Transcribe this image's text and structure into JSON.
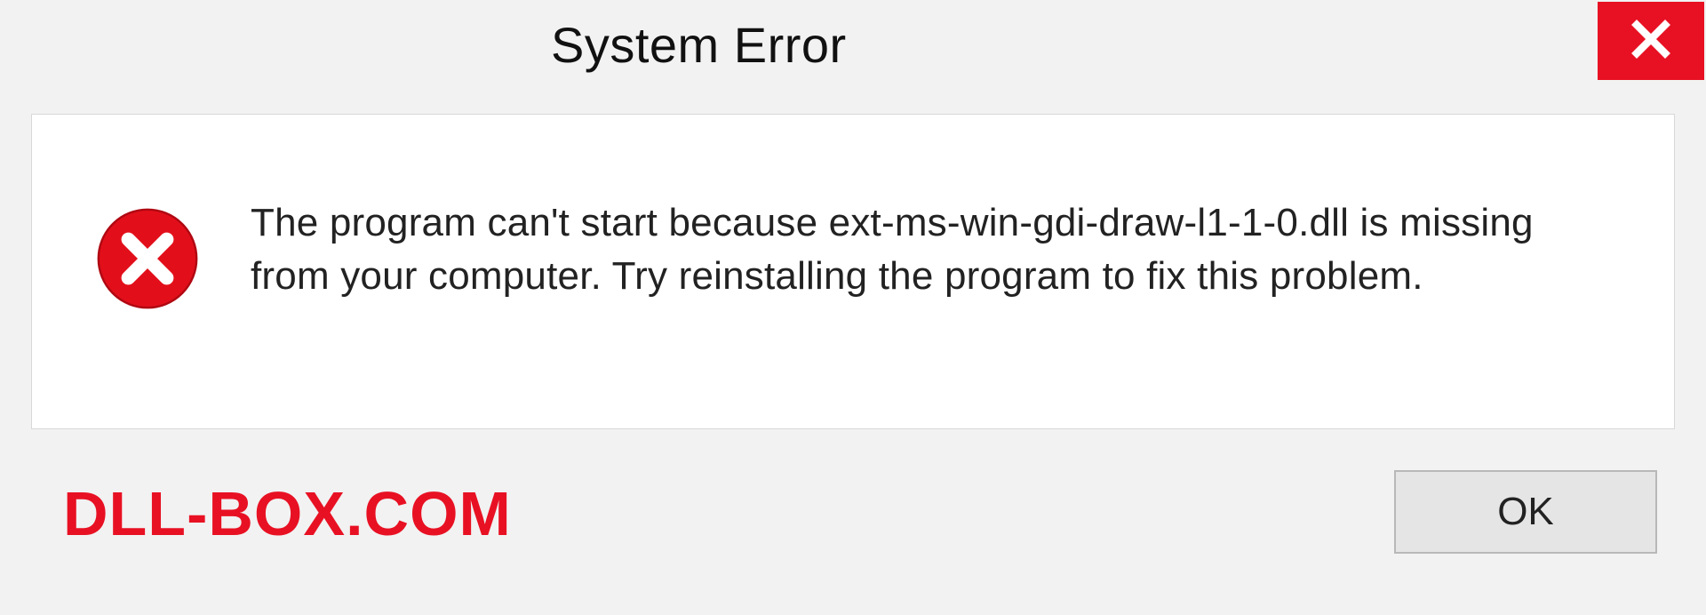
{
  "titlebar": {
    "title": "System Error"
  },
  "message": {
    "text": "The program can't start because ext-ms-win-gdi-draw-l1-1-0.dll is missing from your computer. Try reinstalling the program to fix this problem."
  },
  "buttons": {
    "ok_label": "OK"
  },
  "watermark": {
    "text": "DLL-BOX.COM"
  },
  "colors": {
    "accent_red": "#e81123",
    "bg_gray": "#f2f2f2",
    "white": "#ffffff"
  }
}
